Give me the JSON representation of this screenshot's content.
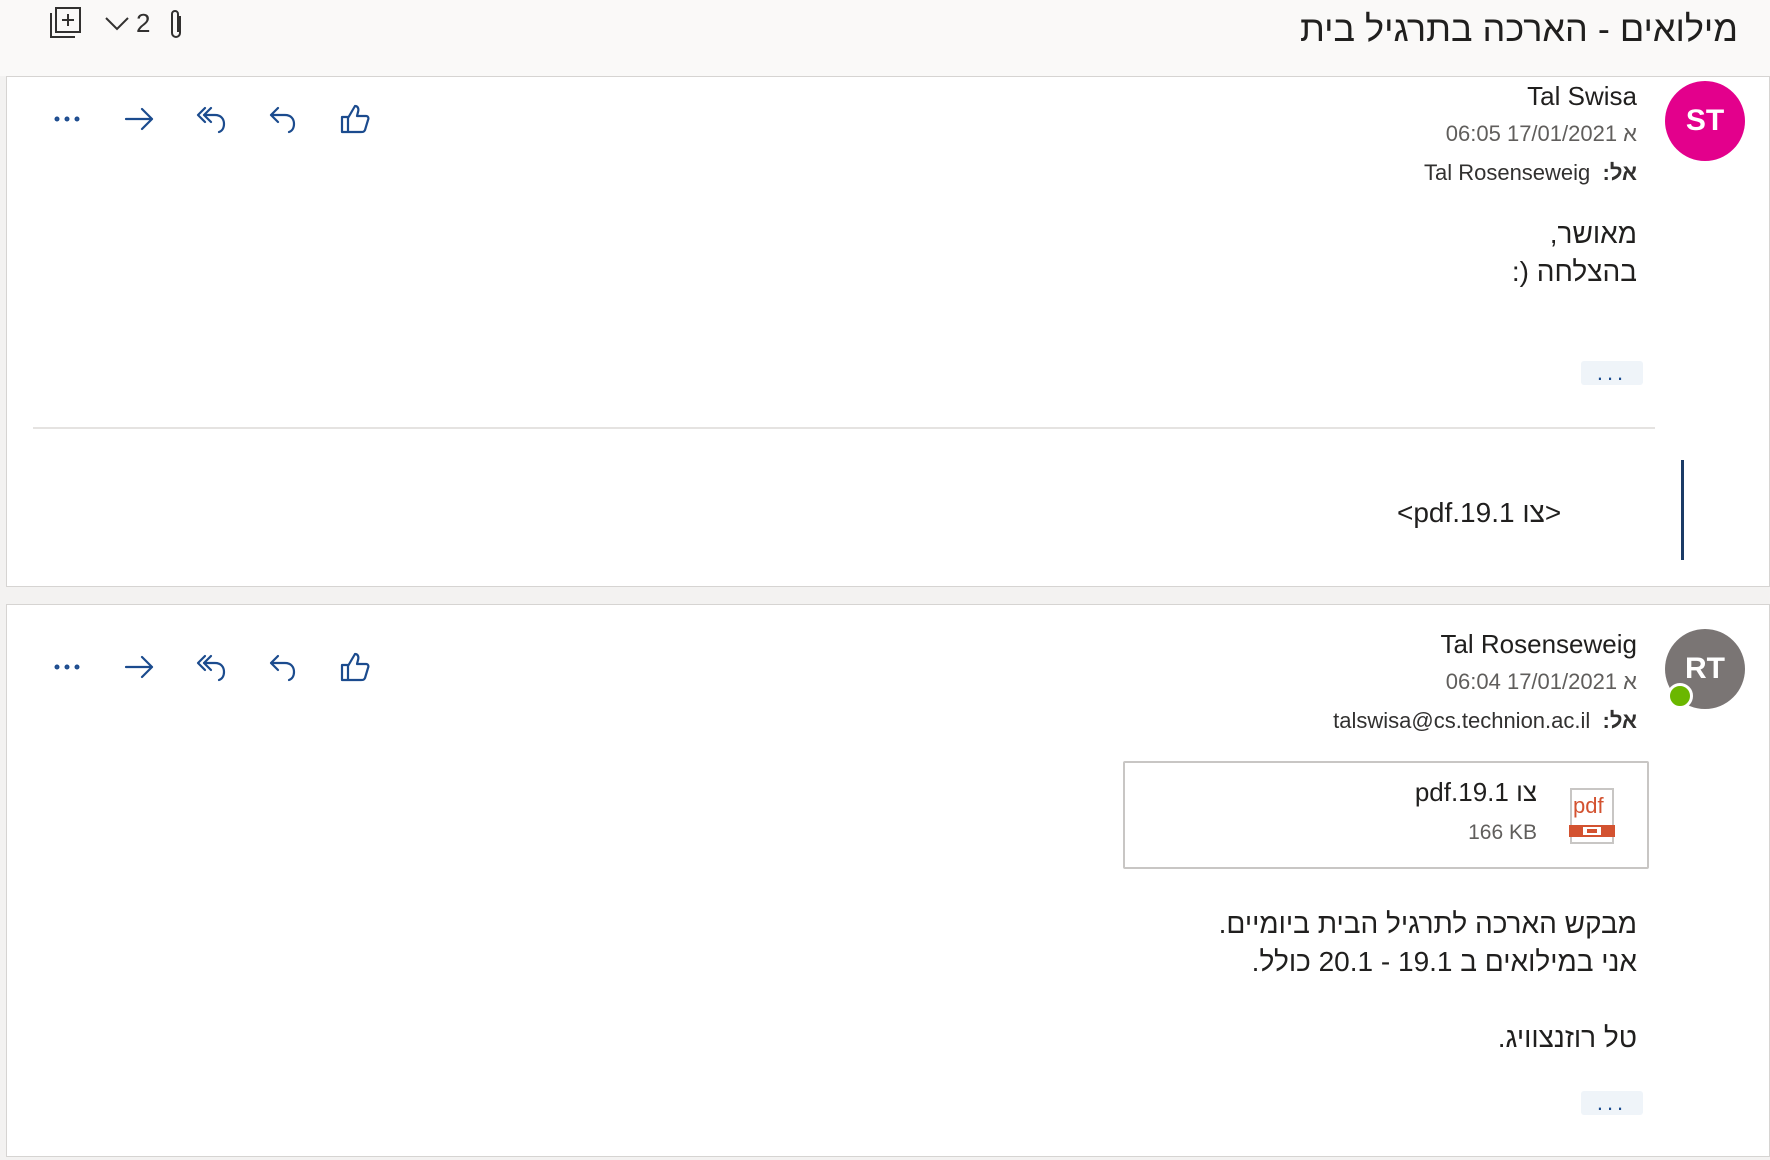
{
  "header": {
    "subject": "מילואים - הארכה בתרגיל בית",
    "message_count": "2",
    "icons": [
      "expand-all-icon",
      "chevron-down-icon",
      "attachment-icon"
    ]
  },
  "actions": [
    "like-icon",
    "reply-icon",
    "reply-all-icon",
    "forward-icon",
    "more-icon"
  ],
  "messages": [
    {
      "initials": "ST",
      "avatar_color": "#e3008c",
      "sender": "Tal Swisa",
      "date": "א 17/01/2021 06:05",
      "to_label": "אל:",
      "to": "Tal Rosenseweig",
      "body": [
        "מאושר,",
        "בהצלחה (:"
      ],
      "more_label": "...",
      "quoted_text": "<pdf.19.1 צו>"
    },
    {
      "initials": "RT",
      "avatar_color": "#7a7574",
      "presence_color": "#6bb700",
      "sender": "Tal Rosenseweig",
      "date": "א 17/01/2021 06:04",
      "to_label": "אל:",
      "to": "talswisa@cs.technion.ac.il",
      "attachment": {
        "name": "צו 19.1.pdf",
        "size": "166 KB",
        "icon_label": "pdf"
      },
      "body": [
        "מבקש הארכה לתרגיל הבית ביומיים.",
        "אני במילואים ב 19.1 - 20.1 כולל.",
        "",
        "טל רוזנצוויג."
      ],
      "more_label": "..."
    }
  ]
}
